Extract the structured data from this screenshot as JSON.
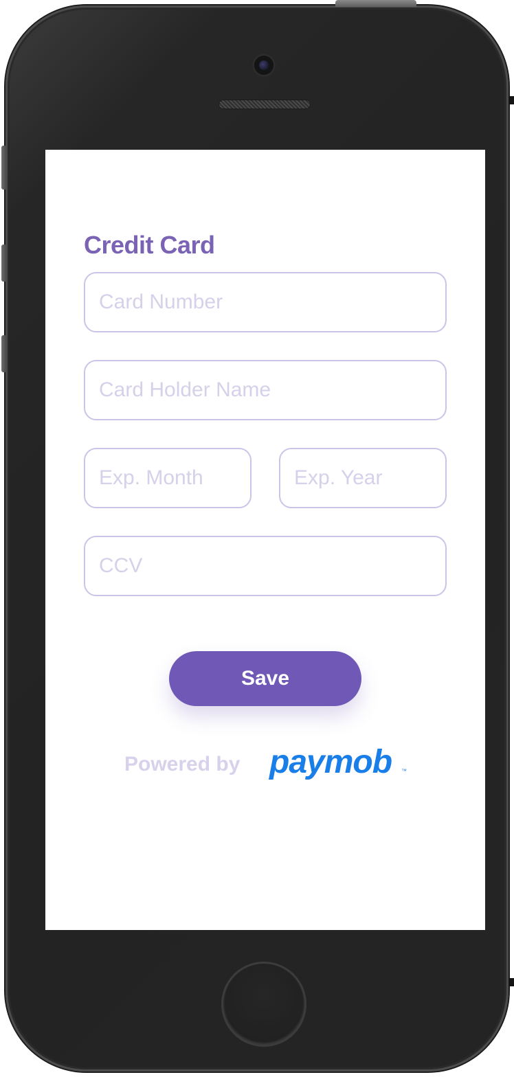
{
  "form": {
    "title": "Credit Card",
    "fields": {
      "card_number": {
        "placeholder": "Card Number",
        "value": ""
      },
      "card_holder": {
        "placeholder": "Card Holder Name",
        "value": ""
      },
      "exp_month": {
        "placeholder": "Exp. Month",
        "value": ""
      },
      "exp_year": {
        "placeholder": "Exp. Year",
        "value": ""
      },
      "ccv": {
        "placeholder": "CCV",
        "value": ""
      }
    },
    "save_label": "Save"
  },
  "footer": {
    "powered_by": "Powered by",
    "brand": "paymob",
    "trademark": "™"
  },
  "colors": {
    "accent": "#7058b6",
    "title": "#7a63b5",
    "field_border": "#cbc3e8",
    "placeholder": "#d6d0ea",
    "brand": "#1a7ee8"
  }
}
